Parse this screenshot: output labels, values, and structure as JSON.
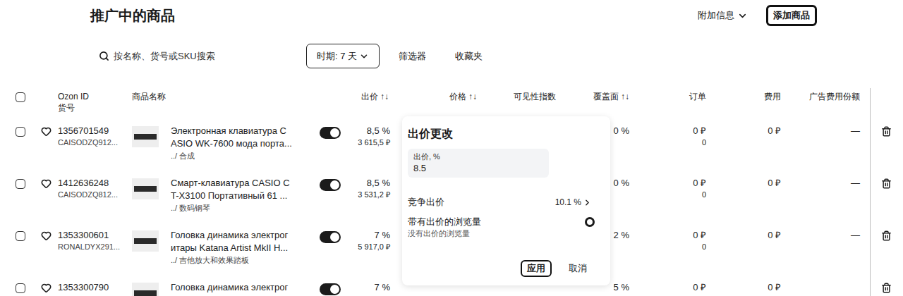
{
  "header": {
    "title": "推广中的商品",
    "extra_info": "附加信息",
    "add_button": "添加商品"
  },
  "toolbar": {
    "search_placeholder": "按名称、货号或SKU搜索",
    "period": "时期: 7 天",
    "filters": "筛选器",
    "favorites": "收藏夹"
  },
  "table": {
    "select_all": false,
    "columns": [
      {
        "label": "Ozon ID",
        "sub": "货号"
      },
      {
        "label": "商品名称"
      },
      {
        "label": "出价 ↑↓"
      },
      {
        "label": "价格 ↑↓"
      },
      {
        "label": "可见性指数"
      },
      {
        "label": "覆盖面 ↑↓"
      },
      {
        "label": "订单"
      },
      {
        "label": "费用"
      },
      {
        "label": "广告费用份额"
      }
    ],
    "rows": [
      {
        "selected": false,
        "favorite": false,
        "ozon_id": "1356701549",
        "sku": "CAISODZQ912...",
        "name_lines": [
          "Электронная клавиатура С",
          "ASIO WK-7600 мода порта..."
        ],
        "category": "../ 合成",
        "on": true,
        "bid": "8,5 %",
        "bid_price": "3 615,5 ₽",
        "coverage": "0 %",
        "orders": "0 ₽",
        "orders_count": "0",
        "cost": "0 ₽",
        "ad_share": "—"
      },
      {
        "selected": false,
        "favorite": false,
        "ozon_id": "1412636248",
        "sku": "CAISODZQ812...",
        "name_lines": [
          "Смарт-клавиатура CASIO C",
          "T-X3100 Портативный 61 ..."
        ],
        "category": "../ 数码钢琴",
        "on": true,
        "bid": "8,5 %",
        "bid_price": "3 531,2 ₽",
        "coverage": "0 %",
        "orders": "0 ₽",
        "orders_count": "0",
        "cost": "0 ₽",
        "ad_share": "—"
      },
      {
        "selected": false,
        "favorite": false,
        "ozon_id": "1353300601",
        "sku": "RONALDYX291...",
        "name_lines": [
          "Головка динамика электрог",
          "итары Katana Artist MkII H..."
        ],
        "category": "../ 吉他放大和效果踏板",
        "on": true,
        "bid": "7 %",
        "bid_price": "5 917,0 ₽",
        "coverage": "2 %",
        "orders": "0 ₽",
        "orders_count": "0",
        "cost": "0 ₽",
        "ad_share": "—"
      },
      {
        "selected": false,
        "favorite": false,
        "ozon_id": "1353300790",
        "name_lines": [
          "Головка динамика электрог"
        ],
        "on": true,
        "bid": "7 %",
        "coverage": "5 %",
        "orders": "0 ₽",
        "cost": "0 ₽"
      }
    ]
  },
  "bid_popup": {
    "title": "出价更改",
    "bid_label": "出价, %",
    "bid_value": "8.5",
    "competitive_label": "竞争出价",
    "competitive_value": "10.1 %",
    "views_label": "带有出价的浏览量",
    "views_sub": "没有出价的浏览量",
    "apply": "应用",
    "cancel": "取消"
  }
}
